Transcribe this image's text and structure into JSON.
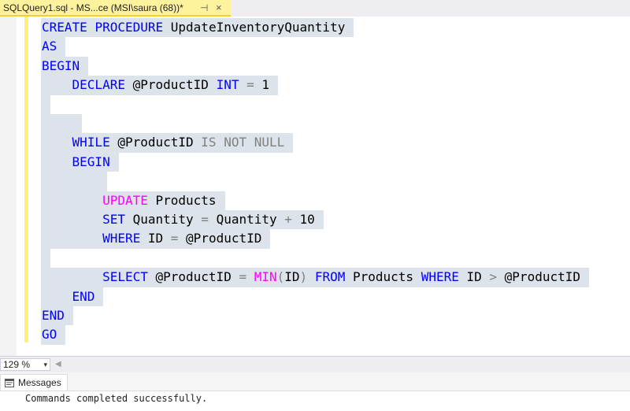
{
  "tab": {
    "title": "SQLQuery1.sql - MS...ce (MSI\\saura (68))*",
    "pin_glyph": "⊣",
    "close_glyph": "×"
  },
  "code": {
    "lines": [
      {
        "indent": "",
        "tokens": [
          {
            "t": "CREATE",
            "c": "kw"
          },
          {
            "t": " ",
            "c": "id"
          },
          {
            "t": "PROCEDURE",
            "c": "kw"
          },
          {
            "t": " UpdateInventoryQuantity",
            "c": "id"
          }
        ]
      },
      {
        "indent": "",
        "tokens": [
          {
            "t": "AS",
            "c": "kw"
          }
        ]
      },
      {
        "indent": "",
        "tokens": [
          {
            "t": "BEGIN",
            "c": "kw"
          }
        ]
      },
      {
        "indent": "    ",
        "tokens": [
          {
            "t": "DECLARE",
            "c": "kw"
          },
          {
            "t": " @ProductID ",
            "c": "id"
          },
          {
            "t": "INT",
            "c": "kw"
          },
          {
            "t": " ",
            "c": "id"
          },
          {
            "t": "=",
            "c": "gray"
          },
          {
            "t": " 1",
            "c": "id"
          }
        ]
      },
      {
        "indent": "",
        "tokens": []
      },
      {
        "indent": "",
        "tokens": []
      },
      {
        "indent": "    ",
        "tokens": [
          {
            "t": "WHILE",
            "c": "kw"
          },
          {
            "t": " @ProductID ",
            "c": "id"
          },
          {
            "t": "IS NOT NULL",
            "c": "gray"
          }
        ]
      },
      {
        "indent": "    ",
        "tokens": [
          {
            "t": "BEGIN",
            "c": "kw"
          }
        ]
      },
      {
        "indent": "",
        "tokens": []
      },
      {
        "indent": "        ",
        "tokens": [
          {
            "t": "UPDATE",
            "c": "fn"
          },
          {
            "t": " Products",
            "c": "id"
          }
        ]
      },
      {
        "indent": "        ",
        "tokens": [
          {
            "t": "SET",
            "c": "kw"
          },
          {
            "t": " Quantity ",
            "c": "id"
          },
          {
            "t": "=",
            "c": "gray"
          },
          {
            "t": " Quantity ",
            "c": "id"
          },
          {
            "t": "+",
            "c": "gray"
          },
          {
            "t": " 10",
            "c": "id"
          }
        ]
      },
      {
        "indent": "        ",
        "tokens": [
          {
            "t": "WHERE",
            "c": "kw"
          },
          {
            "t": " ID ",
            "c": "id"
          },
          {
            "t": "=",
            "c": "gray"
          },
          {
            "t": " @ProductID",
            "c": "id"
          }
        ]
      },
      {
        "indent": "",
        "tokens": []
      },
      {
        "indent": "        ",
        "tokens": [
          {
            "t": "SELECT",
            "c": "kw"
          },
          {
            "t": " @ProductID ",
            "c": "id"
          },
          {
            "t": "=",
            "c": "gray"
          },
          {
            "t": " ",
            "c": "id"
          },
          {
            "t": "MIN",
            "c": "fn"
          },
          {
            "t": "(",
            "c": "gray"
          },
          {
            "t": "ID",
            "c": "id"
          },
          {
            "t": ")",
            "c": "gray"
          },
          {
            "t": " ",
            "c": "id"
          },
          {
            "t": "FROM",
            "c": "kw"
          },
          {
            "t": " Products ",
            "c": "id"
          },
          {
            "t": "WHERE",
            "c": "kw"
          },
          {
            "t": " ID ",
            "c": "id"
          },
          {
            "t": ">",
            "c": "gray"
          },
          {
            "t": " @ProductID",
            "c": "id"
          }
        ]
      },
      {
        "indent": "    ",
        "tokens": [
          {
            "t": "END",
            "c": "kw"
          }
        ]
      },
      {
        "indent": "",
        "tokens": [
          {
            "t": "END",
            "c": "kw"
          }
        ]
      },
      {
        "indent": "",
        "tokens": [
          {
            "t": "GO",
            "c": "kw"
          }
        ]
      }
    ]
  },
  "zoom": {
    "value": "129 %",
    "arrow_glyph": "▾"
  },
  "results": {
    "tab_label": "Messages",
    "message": "Commands completed successfully."
  },
  "colors": {
    "keyword": "#0000ff",
    "operator": "#808080",
    "function": "#ff00ff",
    "selection": "#dde3ea",
    "tab_active": "#fff29d"
  }
}
